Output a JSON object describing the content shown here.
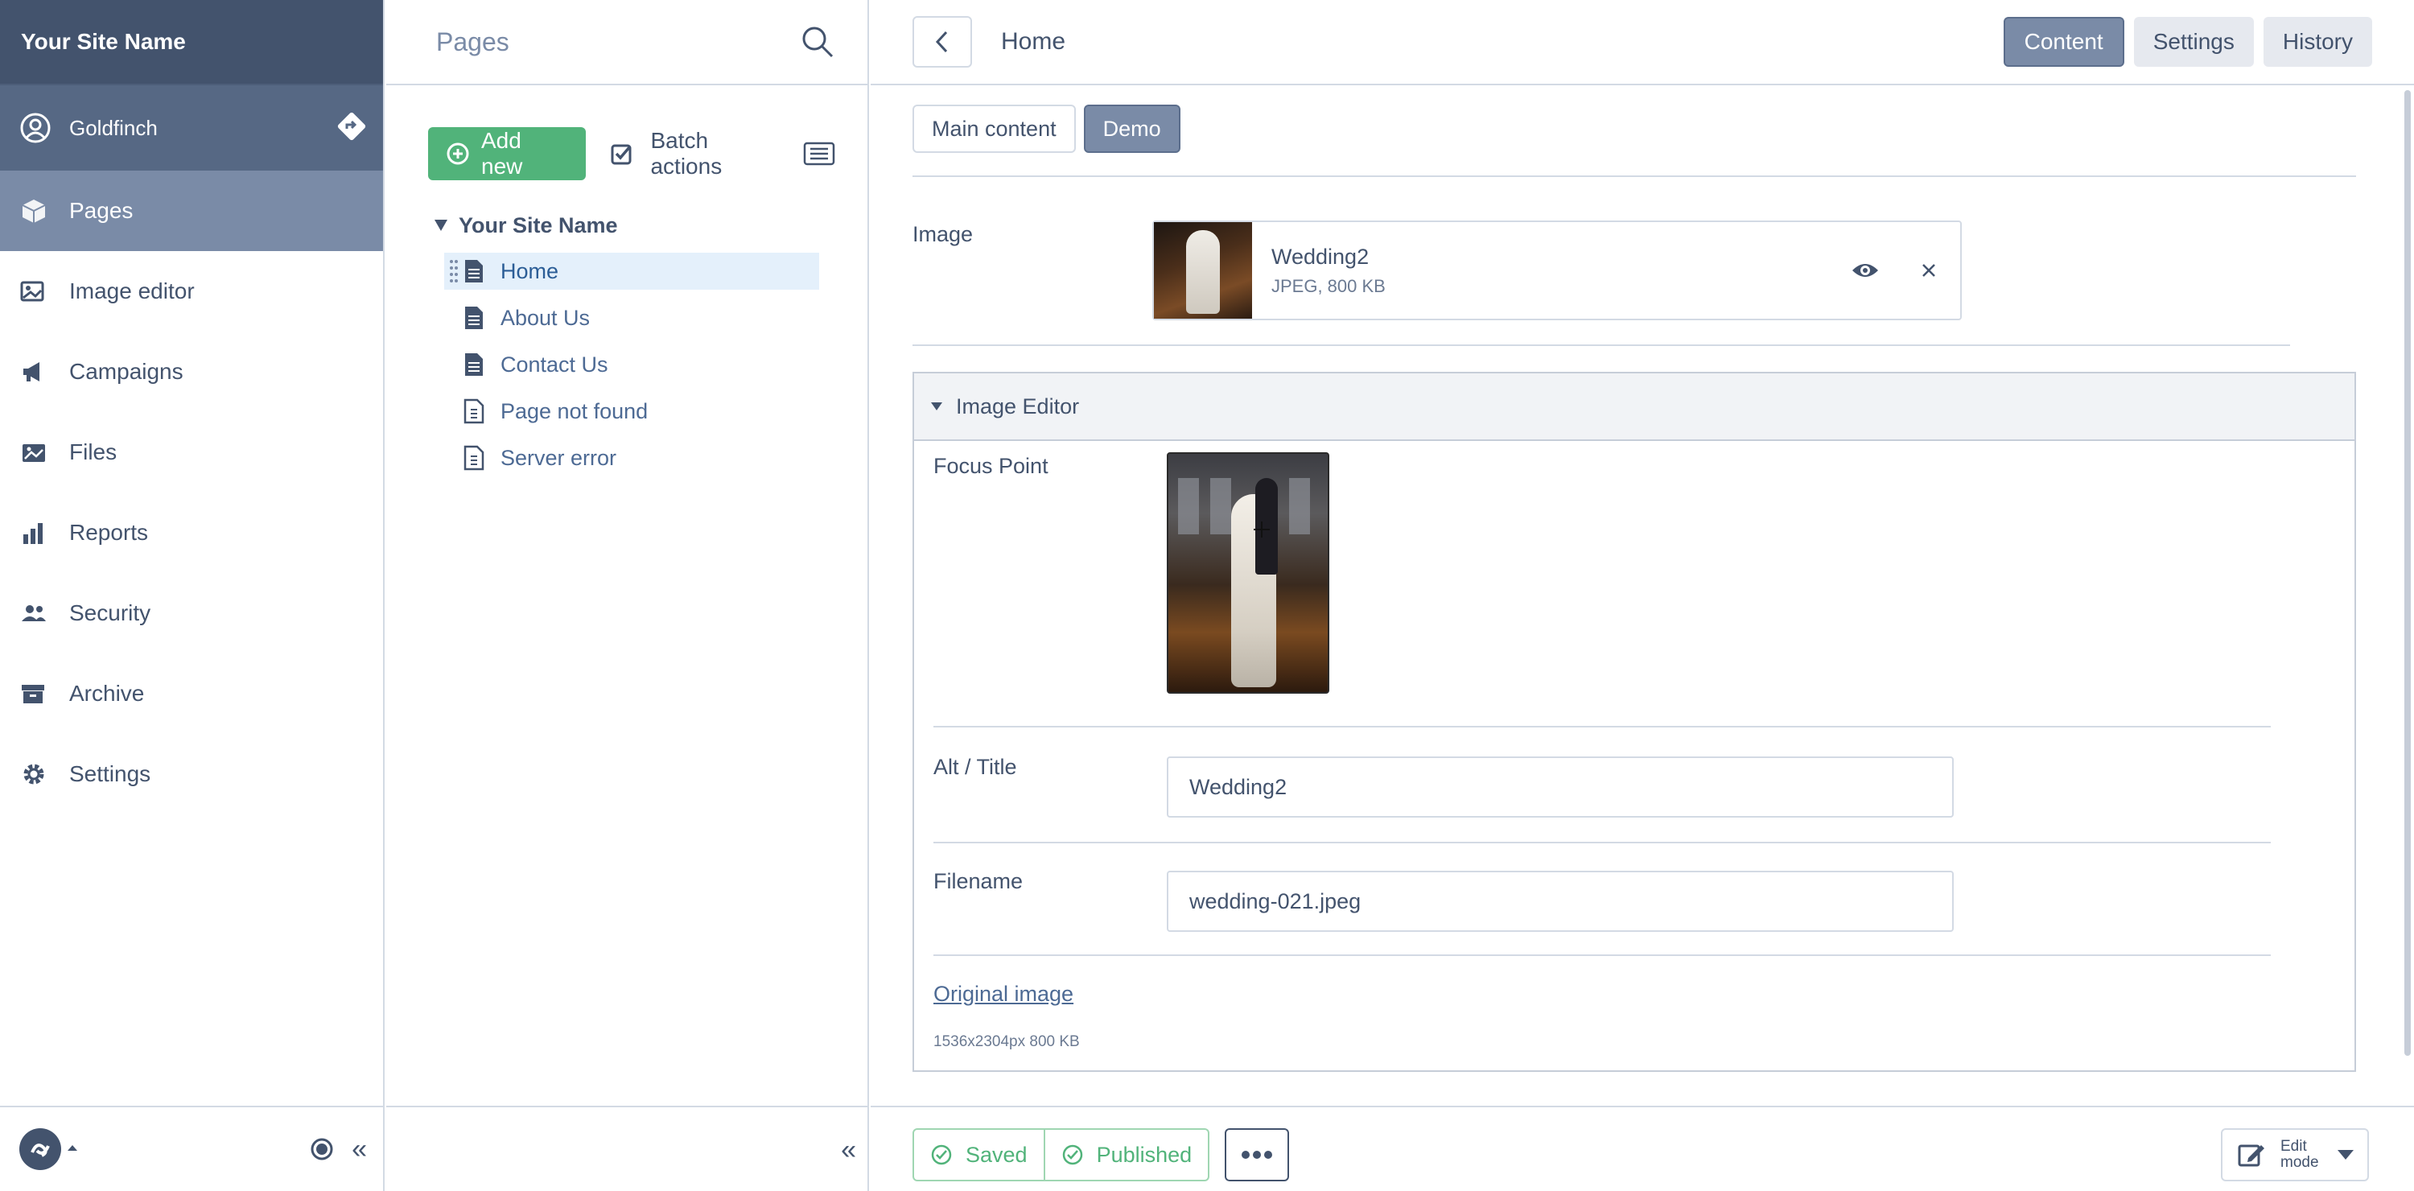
{
  "menu": {
    "site_name": "Your Site Name",
    "profile_name": "Goldfinch",
    "items": [
      {
        "label": "Pages",
        "icon": "pages-icon"
      },
      {
        "label": "Image editor",
        "icon": "image-icon"
      },
      {
        "label": "Campaigns",
        "icon": "megaphone-icon"
      },
      {
        "label": "Files",
        "icon": "files-icon"
      },
      {
        "label": "Reports",
        "icon": "chart-icon"
      },
      {
        "label": "Security",
        "icon": "users-icon"
      },
      {
        "label": "Archive",
        "icon": "archive-icon"
      },
      {
        "label": "Settings",
        "icon": "gear-icon"
      }
    ],
    "collapse_label": "«"
  },
  "tree": {
    "title": "Pages",
    "add_label": "Add new",
    "batch_label": "Batch actions",
    "root_label": "Your Site Name",
    "nodes": [
      {
        "label": "Home"
      },
      {
        "label": "About Us"
      },
      {
        "label": "Contact Us"
      },
      {
        "label": "Page not found"
      },
      {
        "label": "Server error"
      }
    ],
    "collapse_label": "«"
  },
  "editor": {
    "title": "Home",
    "tabs": [
      {
        "label": "Content"
      },
      {
        "label": "Settings"
      },
      {
        "label": "History"
      }
    ],
    "subtabs": [
      {
        "label": "Main content"
      },
      {
        "label": "Demo"
      }
    ],
    "image": {
      "label": "Image",
      "name": "Wedding2",
      "info": "JPEG, 800 KB"
    },
    "image_editor": {
      "title": "Image Editor",
      "focus_label": "Focus Point",
      "alt_label": "Alt / Title",
      "alt_value": "Wedding2",
      "filename_label": "Filename",
      "filename_value": "wedding-021.jpeg",
      "original_link": "Original image",
      "original_info": "1536x2304px 800 KB"
    },
    "footer": {
      "saved_label": "Saved",
      "published_label": "Published",
      "edit_mode_label": "Edit mode"
    }
  },
  "colors": {
    "nav_dark": "#43536d",
    "nav_active": "#7a8ba7",
    "success": "#51b37a",
    "selected_bg": "#e4f0fb"
  }
}
